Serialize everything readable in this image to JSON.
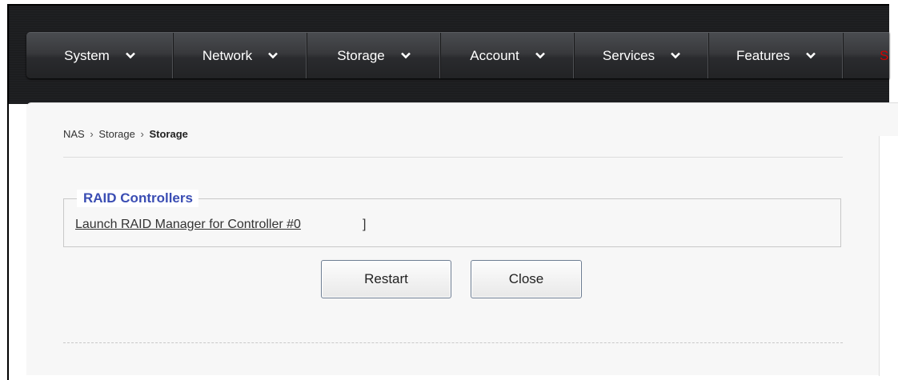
{
  "nav": {
    "items": [
      {
        "label": "System"
      },
      {
        "label": "Network"
      },
      {
        "label": "Storage"
      },
      {
        "label": "Account"
      },
      {
        "label": "Services"
      },
      {
        "label": "Features"
      }
    ],
    "cut_label": "S"
  },
  "breadcrumb": {
    "root": "NAS",
    "section": "Storage",
    "current": "Storage",
    "separator": "›"
  },
  "raid": {
    "legend": "RAID Controllers",
    "link_text": "Launch RAID Manager for Controller #0",
    "trailing": "]"
  },
  "buttons": {
    "restart": "Restart",
    "close": "Close"
  },
  "colors": {
    "legend": "#3a4db3",
    "navbar": "#38393c",
    "accent_cut": "#d40000"
  },
  "icons": {
    "nav_dropdown": "chevron-down-icon"
  }
}
